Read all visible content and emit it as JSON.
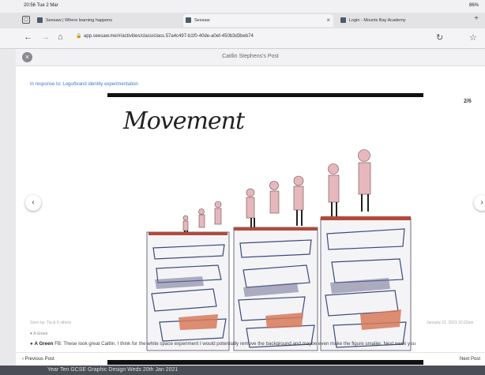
{
  "status": {
    "time": "20:56 Tue 2 Mar",
    "battery": "86%"
  },
  "tabs": [
    {
      "label": "Seesaw | Where learning happens"
    },
    {
      "label": "Seesaw"
    },
    {
      "label": "Login - Mounts Bay Academy"
    }
  ],
  "url": "app.seesaw.me/#/activities/class/class.57a4c497-b1f0-40de-a0ef-450b3d3beb74",
  "post": {
    "title": "Caitlin Stephens's Post",
    "response_to": "In response to: Logo/brand identity experimentation",
    "counter": "2/6",
    "art_title": "Movement",
    "meta": "Seen by: Tia & 6 others",
    "date": "January 22, 2021 10:22am",
    "likes": "A Green",
    "comment_author": "A Green",
    "comment_text": "FB: These look great Caitlin, I think for the white space experiment I would potentially remove the background and maybe even make the figure smaller. Next week you"
  },
  "footer": {
    "prev": "Previous Post",
    "next": "Next Post"
  },
  "background_strip": "Year Ten GCSE Graphic Design Weds 20th Jan 2021"
}
